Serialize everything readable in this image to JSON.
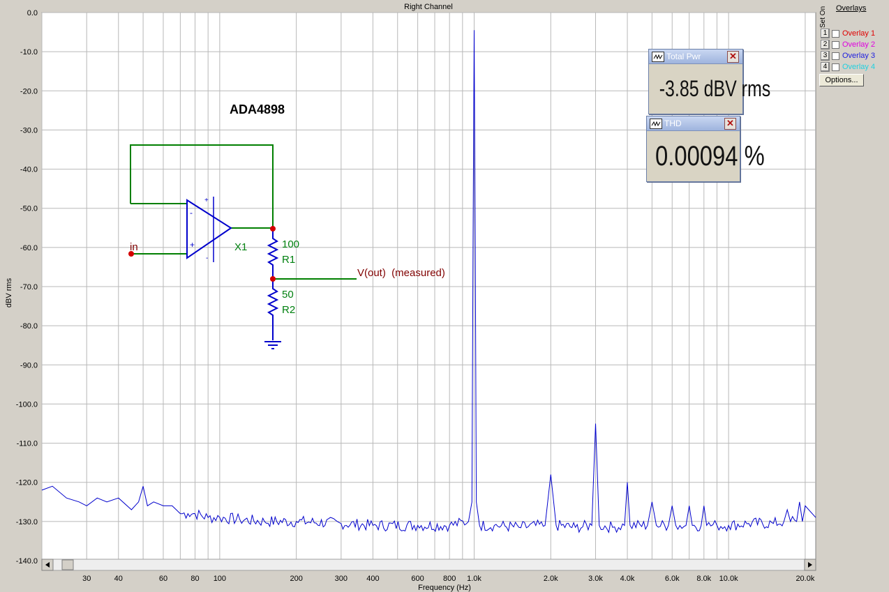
{
  "colors": {
    "trace": "#0000cc",
    "grid": "#b8b8b8",
    "plot_bg": "#ffffff",
    "schematic_wire": "#007f00",
    "schematic_part": "#0000cc",
    "schematic_node": "#d40000",
    "schematic_label_green": "#00800f",
    "schematic_label_red": "#800000"
  },
  "overlays": {
    "title": "Overlays",
    "set_on_label": "Set On",
    "items": [
      {
        "num": "1",
        "label": "Overlay 1",
        "color": "#e00000"
      },
      {
        "num": "2",
        "label": "Overlay 2",
        "color": "#e000e0"
      },
      {
        "num": "3",
        "label": "Overlay 3",
        "color": "#2020e0"
      },
      {
        "num": "4",
        "label": "Overlay 4",
        "color": "#20d0e0"
      }
    ],
    "options_label": "Options..."
  },
  "meters": {
    "total_pwr": {
      "title": "Total Pwr",
      "value": "-3.85 dBV rms"
    },
    "thd": {
      "title": "THD",
      "value": "0.00094 %"
    }
  },
  "schematic": {
    "part_name": "ADA4898",
    "in_label": "in",
    "x1_label": "X1",
    "r1_value": "100",
    "r1_name": "R1",
    "r2_value": "50",
    "r2_name": "R2",
    "vout_label": "V(out)  (measured)"
  },
  "chart_data": {
    "type": "line",
    "title": "Right Channel",
    "xlabel": "Frequency (Hz)",
    "ylabel": "dBV rms",
    "x_scale": "log",
    "xlim": [
      20,
      22000
    ],
    "ylim": [
      -140,
      0
    ],
    "grid": true,
    "x_ticks": [
      {
        "value": 30,
        "label": "30"
      },
      {
        "value": 40,
        "label": "40"
      },
      {
        "value": 60,
        "label": "60"
      },
      {
        "value": 80,
        "label": "80"
      },
      {
        "value": 100,
        "label": "100"
      },
      {
        "value": 200,
        "label": "200"
      },
      {
        "value": 300,
        "label": "300"
      },
      {
        "value": 400,
        "label": "400"
      },
      {
        "value": 600,
        "label": "600"
      },
      {
        "value": 800,
        "label": "800"
      },
      {
        "value": 1000,
        "label": "1.0k"
      },
      {
        "value": 2000,
        "label": "2.0k"
      },
      {
        "value": 3000,
        "label": "3.0k"
      },
      {
        "value": 4000,
        "label": "4.0k"
      },
      {
        "value": 6000,
        "label": "6.0k"
      },
      {
        "value": 8000,
        "label": "8.0k"
      },
      {
        "value": 10000,
        "label": "10.0k"
      },
      {
        "value": 20000,
        "label": "20.0k"
      }
    ],
    "y_ticks": [
      {
        "value": 0,
        "label": "0.0"
      },
      {
        "value": -10,
        "label": "-10.0"
      },
      {
        "value": -20,
        "label": "-20.0"
      },
      {
        "value": -30,
        "label": "-30.0"
      },
      {
        "value": -40,
        "label": "-40.0"
      },
      {
        "value": -50,
        "label": "-50.0"
      },
      {
        "value": -60,
        "label": "-60.0"
      },
      {
        "value": -70,
        "label": "-70.0"
      },
      {
        "value": -80,
        "label": "-80.0"
      },
      {
        "value": -90,
        "label": "-90.0"
      },
      {
        "value": -100,
        "label": "-100.0"
      },
      {
        "value": -110,
        "label": "-110.0"
      },
      {
        "value": -120,
        "label": "-120.0"
      },
      {
        "value": -130,
        "label": "-130.0"
      },
      {
        "value": -140,
        "label": "-140.0"
      }
    ],
    "series": [
      {
        "type": "spectrum",
        "x": [
          20,
          22,
          25,
          28,
          30,
          33,
          36,
          40,
          45,
          48,
          50,
          52,
          55,
          60,
          65,
          70,
          75,
          80,
          90,
          100,
          120,
          150,
          200,
          300,
          400,
          600,
          800,
          950,
          980,
          990,
          1000,
          1010,
          1020,
          1050,
          1200,
          1500,
          1900,
          2000,
          2100,
          2500,
          2900,
          3000,
          3100,
          3500,
          3900,
          4000,
          4100,
          4800,
          5000,
          5200,
          5800,
          6000,
          6200,
          6800,
          7000,
          7200,
          7800,
          8000,
          8200,
          9000,
          10000,
          12000,
          15000,
          16500,
          17000,
          17500,
          18500,
          19000,
          19500,
          20000,
          22000
        ],
        "y": [
          -122,
          -121,
          -124,
          -125,
          -126,
          -124,
          -125,
          -124,
          -127,
          -125,
          -121,
          -126,
          -125,
          -126,
          -126,
          -128,
          -128,
          -128,
          -129,
          -129,
          -129.5,
          -130,
          -130,
          -130.5,
          -131,
          -131,
          -131,
          -130,
          -125,
          -60,
          -4.5,
          -60,
          -125,
          -131,
          -131,
          -131.5,
          -131,
          -118,
          -131,
          -131.5,
          -131,
          -105,
          -131,
          -131.5,
          -131,
          -120,
          -131,
          -131,
          -125,
          -131,
          -131,
          -126,
          -131,
          -131,
          -126,
          -131,
          -131,
          -126,
          -131,
          -131,
          -131,
          -130.5,
          -130.5,
          -130,
          -127,
          -130,
          -130,
          -125,
          -130,
          -126,
          -129
        ]
      }
    ]
  }
}
